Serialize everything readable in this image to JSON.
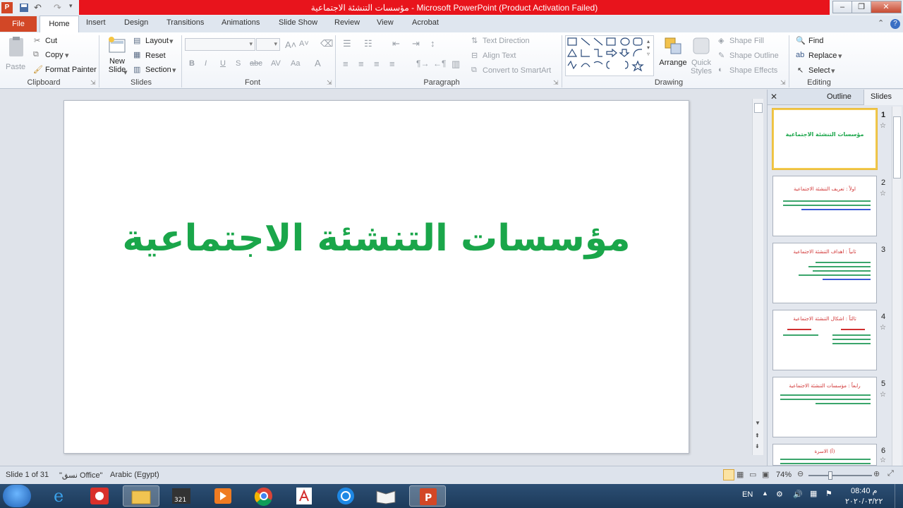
{
  "window": {
    "title": "مؤسسات التنشئة الاجتماعية - Microsoft PowerPoint (Product Activation Failed)"
  },
  "tabs": [
    {
      "label": "File"
    },
    {
      "label": "Home"
    },
    {
      "label": "Insert"
    },
    {
      "label": "Design"
    },
    {
      "label": "Transitions"
    },
    {
      "label": "Animations"
    },
    {
      "label": "Slide Show"
    },
    {
      "label": "Review"
    },
    {
      "label": "View"
    },
    {
      "label": "Acrobat"
    }
  ],
  "ribbon": {
    "clipboard": {
      "label": "Clipboard",
      "paste": "Paste",
      "cut": "Cut",
      "copy": "Copy",
      "format_painter": "Format Painter"
    },
    "slides": {
      "label": "Slides",
      "new_slide": "New",
      "new_slide2": "Slide",
      "layout": "Layout",
      "reset": "Reset",
      "section": "Section"
    },
    "font": {
      "label": "Font"
    },
    "paragraph": {
      "label": "Paragraph",
      "text_direction": "Text Direction",
      "align_text": "Align Text",
      "smartart": "Convert to SmartArt"
    },
    "drawing": {
      "label": "Drawing",
      "arrange": "Arrange",
      "quick_styles": "Quick",
      "quick_styles2": "Styles",
      "shape_fill": "Shape Fill",
      "shape_outline": "Shape Outline",
      "shape_effects": "Shape Effects"
    },
    "editing": {
      "label": "Editing",
      "find": "Find",
      "replace": "Replace",
      "select": "Select"
    }
  },
  "slide": {
    "title": "مؤسسات التنشئة الاجتماعية",
    "title_color": "#1aa64a"
  },
  "pane": {
    "outline_tab": "Outline",
    "slides_tab": "Slides",
    "thumbs": [
      {
        "num": "1",
        "title": "مؤسسات التنشئة الاجتماعية"
      },
      {
        "num": "2",
        "title": "اولاً : تعريف التنشئة الاجتماعية"
      },
      {
        "num": "3",
        "title": "ثانياً : اهداف التنشئة الاجتماعية"
      },
      {
        "num": "4",
        "title": "ثالثاً : اشكال التنشئة الاجتماعية"
      },
      {
        "num": "5",
        "title": "رابعاً : مؤسسات التنشئة الاجتماعية"
      },
      {
        "num": "6",
        "title": "(أ) الاسرة"
      }
    ]
  },
  "status": {
    "slide_info": "Slide 1 of 31",
    "theme": "\"نسق Office\"",
    "language": "Arabic (Egypt)",
    "zoom": "74%"
  },
  "taskbar": {
    "lang": "EN",
    "time": "08:40 م",
    "date": "٢٠٢٠/٠٣/٢٢"
  }
}
